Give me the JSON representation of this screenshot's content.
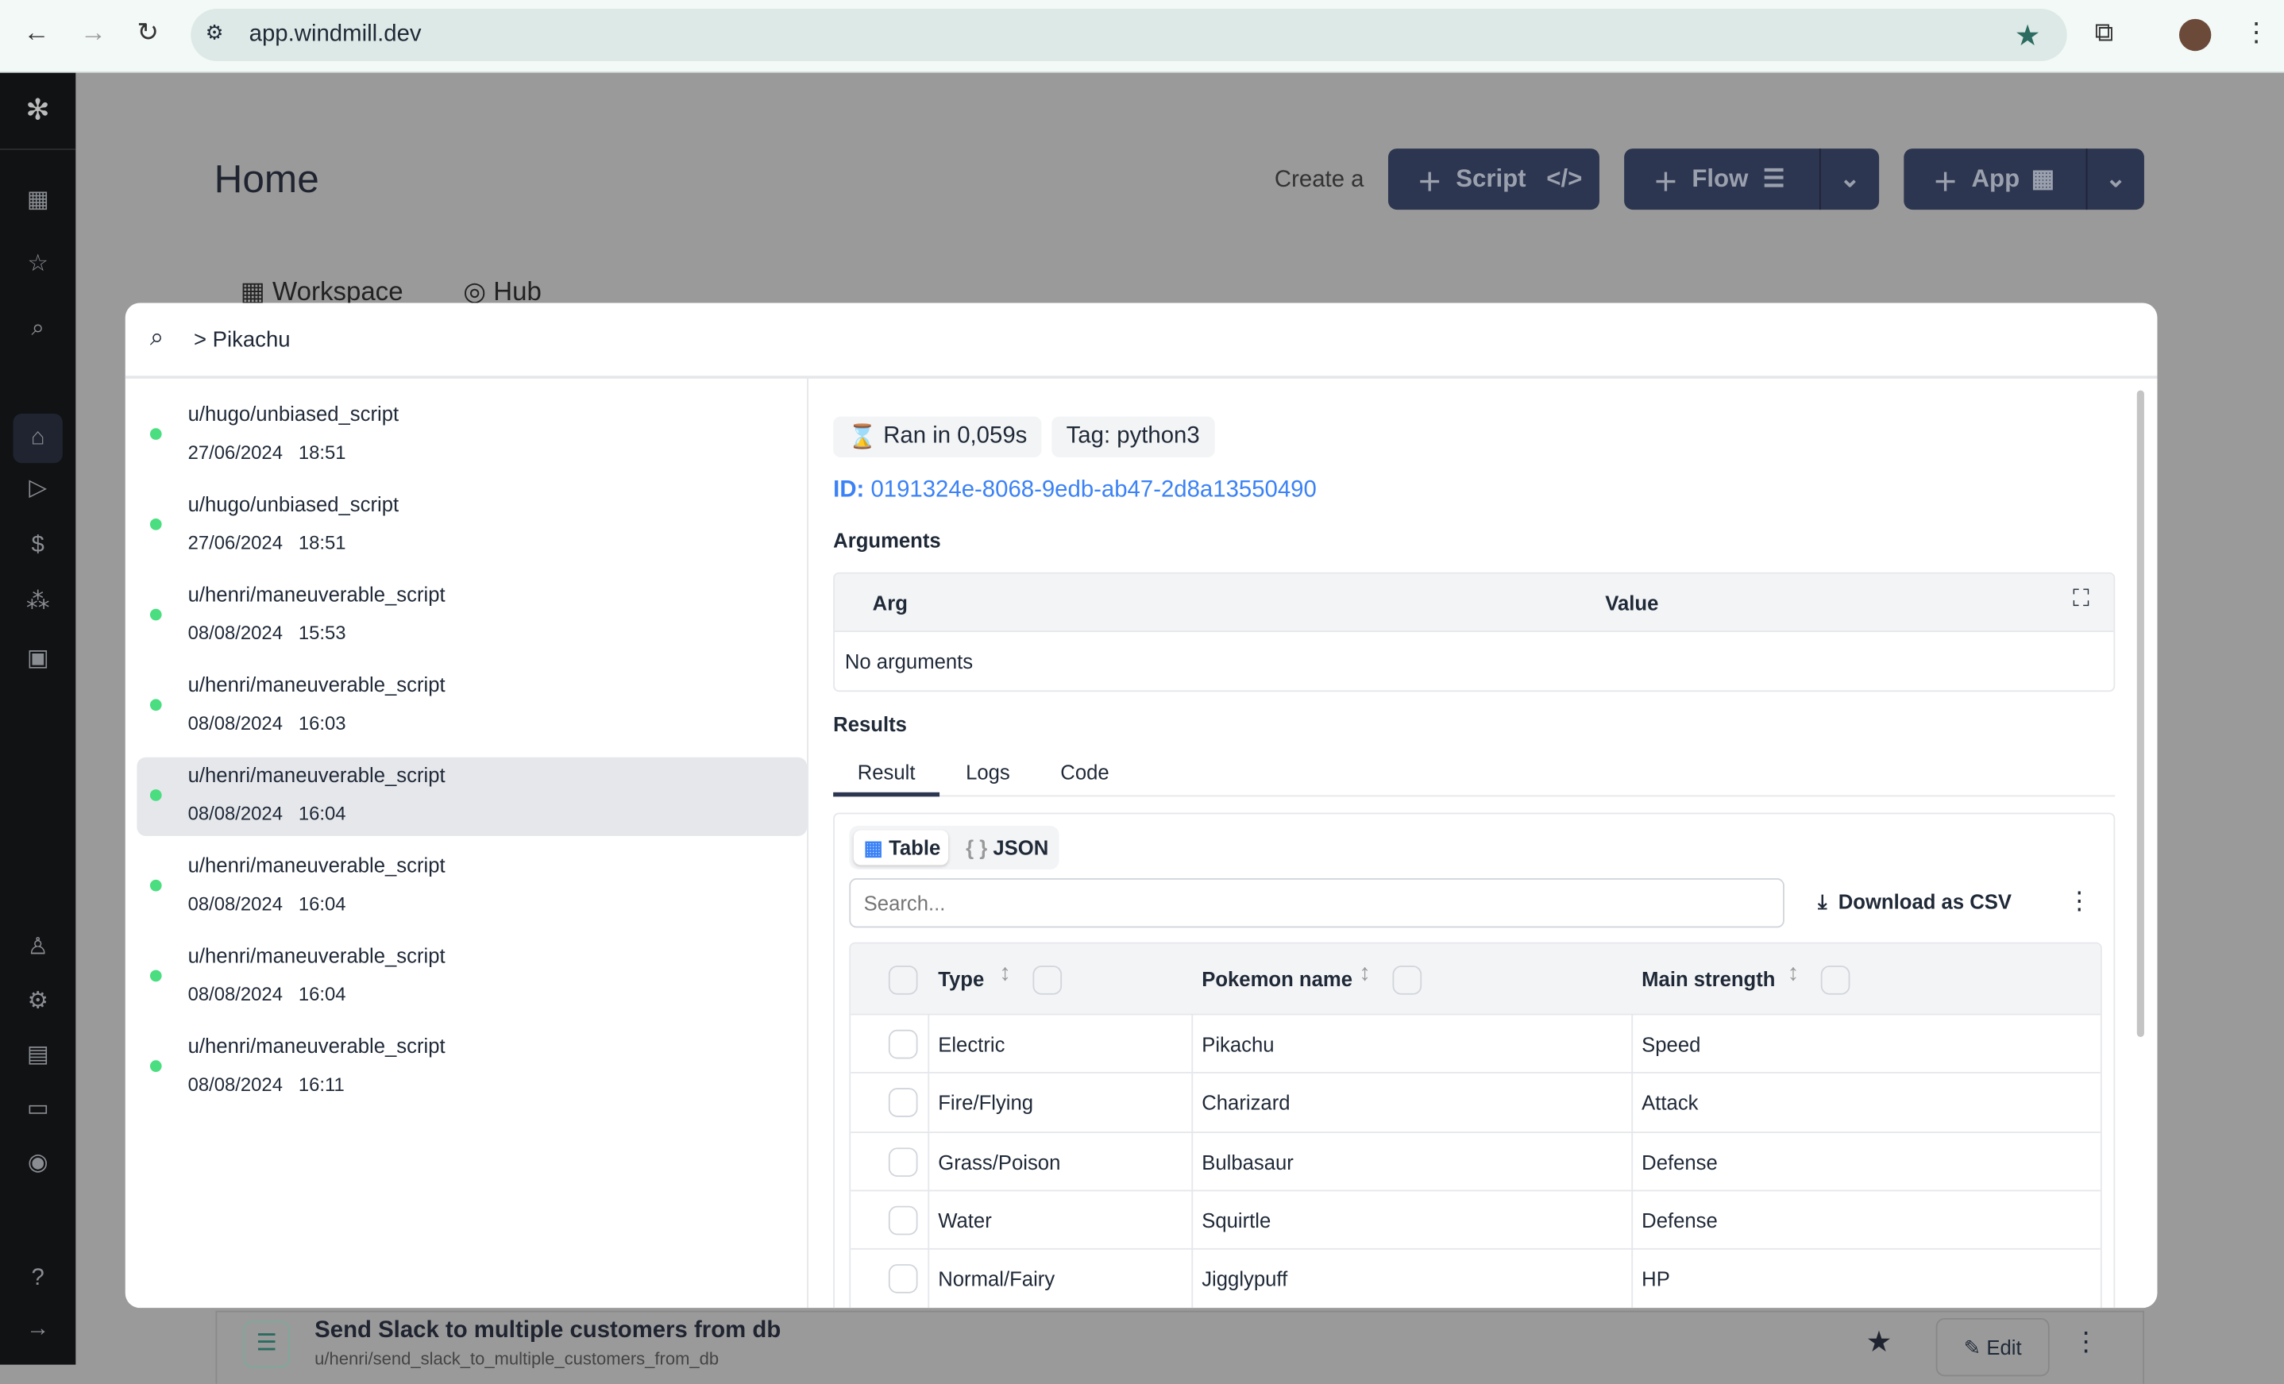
{
  "browser": {
    "url": "app.windmill.dev",
    "icons": [
      "back-icon",
      "forward-icon",
      "reload-icon",
      "site-settings-icon",
      "star-icon",
      "extensions-icon",
      "avatar",
      "menu-icon"
    ]
  },
  "sidebar": {
    "icons": [
      "windmill-logo-icon",
      "workspace-icon",
      "star-icon",
      "search-icon",
      "home-icon",
      "play-icon",
      "dollar-icon",
      "resources-icon",
      "calendar-icon",
      "user-icon",
      "gear-icon",
      "worker-icon",
      "folder-icon",
      "eye-icon",
      "help-icon",
      "expand-icon"
    ]
  },
  "header": {
    "title": "Home",
    "create_label": "Create a",
    "script": "Script",
    "flow": "Flow",
    "app": "App",
    "tabs": [
      "Workspace",
      "Hub"
    ]
  },
  "search": {
    "query": "> Pikachu"
  },
  "runs": [
    {
      "path": "u/hugo/unbiased_script",
      "date": "27/06/2024",
      "time": "18:51",
      "status": "success"
    },
    {
      "path": "u/hugo/unbiased_script",
      "date": "27/06/2024",
      "time": "18:51",
      "status": "success"
    },
    {
      "path": "u/henri/maneuverable_script",
      "date": "08/08/2024",
      "time": "15:53",
      "status": "success"
    },
    {
      "path": "u/henri/maneuverable_script",
      "date": "08/08/2024",
      "time": "16:03",
      "status": "success"
    },
    {
      "path": "u/henri/maneuverable_script",
      "date": "08/08/2024",
      "time": "16:04",
      "status": "success",
      "selected": true
    },
    {
      "path": "u/henri/maneuverable_script",
      "date": "08/08/2024",
      "time": "16:04",
      "status": "success"
    },
    {
      "path": "u/henri/maneuverable_script",
      "date": "08/08/2024",
      "time": "16:04",
      "status": "success"
    },
    {
      "path": "u/henri/maneuverable_script",
      "date": "08/08/2024",
      "time": "16:11",
      "status": "success"
    }
  ],
  "detail": {
    "ran": "Ran in 0,059s",
    "tag": "Tag: python3",
    "id_label": "ID:",
    "id": "0191324e-8068-9edb-ab47-2d8a13550490",
    "arguments_title": "Arguments",
    "arg_col": "Arg",
    "value_col": "Value",
    "no_args": "No arguments",
    "results_title": "Results",
    "tabs": [
      "Result",
      "Logs",
      "Code"
    ],
    "active_tab": "Result",
    "view_table": "Table",
    "view_json": "JSON",
    "search_placeholder": "Search...",
    "download": "Download as CSV",
    "link_color": "#3b82f6"
  },
  "table": {
    "columns": [
      "Type",
      "Pokemon name",
      "Main strength"
    ],
    "rows": [
      [
        "Electric",
        "Pikachu",
        "Speed"
      ],
      [
        "Fire/Flying",
        "Charizard",
        "Attack"
      ],
      [
        "Grass/Poison",
        "Bulbasaur",
        "Defense"
      ],
      [
        "Water",
        "Squirtle",
        "Defense"
      ],
      [
        "Normal/Fairy",
        "Jigglypuff",
        "HP"
      ]
    ]
  },
  "background_item": {
    "title": "Send Slack to multiple customers from db",
    "path": "u/henri/send_slack_to_multiple_customers_from_db",
    "edit": "Edit"
  }
}
